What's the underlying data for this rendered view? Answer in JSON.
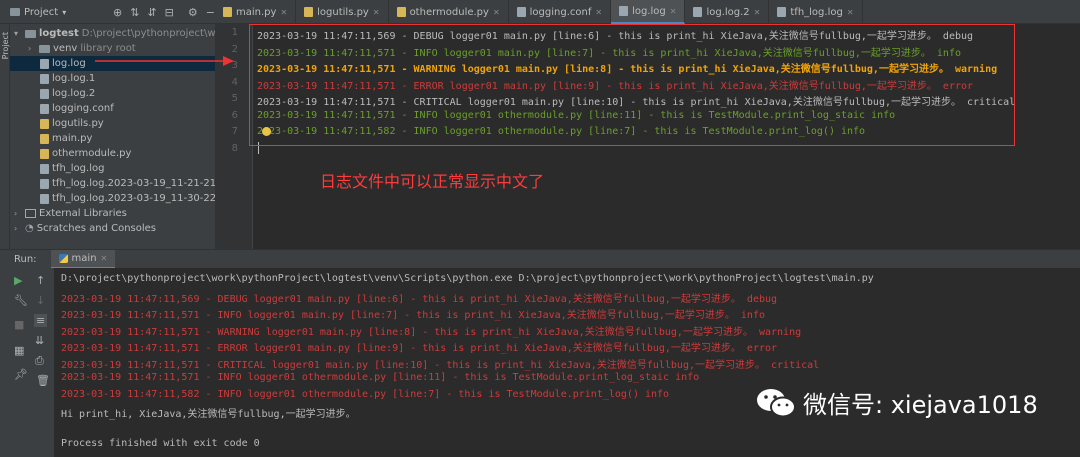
{
  "toolbar": {
    "project_label": "Project",
    "tabs": [
      {
        "label": "main.py",
        "icon_color": "#d6b656"
      },
      {
        "label": "logutils.py",
        "icon_color": "#d6b656"
      },
      {
        "label": "othermodule.py",
        "icon_color": "#d6b656"
      },
      {
        "label": "logging.conf",
        "icon_color": "#9aa7b0"
      },
      {
        "label": "log.log",
        "icon_color": "#9aa7b0"
      },
      {
        "label": "log.log.2",
        "icon_color": "#9aa7b0"
      },
      {
        "label": "tfh_log.log",
        "icon_color": "#9aa7b0"
      }
    ]
  },
  "sidebar_strip": {
    "label": "Project"
  },
  "tree": {
    "root_name": "logtest",
    "root_path": "D:\\project\\pythonproject\\work",
    "venv_name": "venv",
    "venv_hint": "library root",
    "files": [
      "log.log",
      "log.log.1",
      "log.log.2",
      "logging.conf",
      "logutils.py",
      "main.py",
      "othermodule.py",
      "tfh_log.log",
      "tfh_log.log.2023-03-19_11-21-21",
      "tfh_log.log.2023-03-19_11-30-22"
    ],
    "external": "External Libraries",
    "scratches": "Scratches and Consoles"
  },
  "editor": {
    "line_numbers": [
      "1",
      "2",
      "3",
      "4",
      "5",
      "6",
      "7",
      "8"
    ],
    "lines": [
      {
        "text": "2023-03-19 11:47:11,569 - DEBUG logger01 main.py [line:6] - this is print_hi XieJava,关注微信号fullbug,一起学习进步。 debug",
        "color": "#bbbbbb"
      },
      {
        "text": "2023-03-19 11:47:11,571 - INFO logger01 main.py [line:7] - this is print_hi XieJava,关注微信号fullbug,一起学习进步。 info",
        "color": "#6a9f2a"
      },
      {
        "text": "2023-03-19 11:47:11,571 - WARNING logger01 main.py [line:8] - this is print_hi XieJava,关注微信号fullbug,一起学习进步。 warning",
        "color": "#f0a30a"
      },
      {
        "text": "2023-03-19 11:47:11,571 - ERROR logger01 main.py [line:9] - this is print_hi XieJava,关注微信号fullbug,一起学习进步。 error",
        "color": "#ce3b3b"
      },
      {
        "text": "2023-03-19 11:47:11,571 - CRITICAL logger01 main.py [line:10] - this is print_hi XieJava,关注微信号fullbug,一起学习进步。 critical",
        "color": "#bbbbbb"
      },
      {
        "text": "2023-03-19 11:47:11,571 - INFO logger01 othermodule.py [line:11] - this is TestModule.print_log_staic info",
        "color": "#6a9f2a"
      },
      {
        "text": "2023-03-19 11:47:11,582 - INFO logger01 othermodule.py [line:7] - this is TestModule.print_log() info",
        "color": "#6a9f2a"
      },
      {
        "text": "",
        "color": "#bbbbbb"
      }
    ],
    "note": "日志文件中可以正常显示中文了"
  },
  "run": {
    "label": "Run:",
    "tab": "main",
    "lines": [
      {
        "text": "D:\\project\\pythonproject\\work\\pythonProject\\logtest\\venv\\Scripts\\python.exe D:\\project\\pythonproject\\work\\pythonProject\\logtest\\main.py",
        "color": "#bbbbbb"
      },
      {
        "text": "2023-03-19 11:47:11,569 - DEBUG logger01 main.py [line:6] - this is print_hi XieJava,关注微信号fullbug,一起学习进步。 debug",
        "color": "#ce3b3b"
      },
      {
        "text": "2023-03-19 11:47:11,571 - INFO logger01 main.py [line:7] - this is print_hi XieJava,关注微信号fullbug,一起学习进步。 info",
        "color": "#ce3b3b"
      },
      {
        "text": "2023-03-19 11:47:11,571 - WARNING logger01 main.py [line:8] - this is print_hi XieJava,关注微信号fullbug,一起学习进步。 warning",
        "color": "#ce3b3b"
      },
      {
        "text": "2023-03-19 11:47:11,571 - ERROR logger01 main.py [line:9] - this is print_hi XieJava,关注微信号fullbug,一起学习进步。 error",
        "color": "#ce3b3b"
      },
      {
        "text": "2023-03-19 11:47:11,571 - CRITICAL logger01 main.py [line:10] - this is print_hi XieJava,关注微信号fullbug,一起学习进步。 critical",
        "color": "#ce3b3b"
      },
      {
        "text": "2023-03-19 11:47:11,571 - INFO logger01 othermodule.py [line:11] - this is TestModule.print_log_staic info",
        "color": "#ce3b3b"
      },
      {
        "text": "2023-03-19 11:47:11,582 - INFO logger01 othermodule.py [line:7] - this is TestModule.print_log() info",
        "color": "#ce3b3b"
      },
      {
        "text": "Hi print_hi, XieJava,关注微信号fullbug,一起学习进步。",
        "color": "#bbbbbb"
      },
      {
        "text": "",
        "color": "#bbbbbb"
      },
      {
        "text": "Process finished with exit code 0",
        "color": "#bbbbbb"
      }
    ]
  },
  "watermark": {
    "text": "微信号: xiejava1018"
  }
}
